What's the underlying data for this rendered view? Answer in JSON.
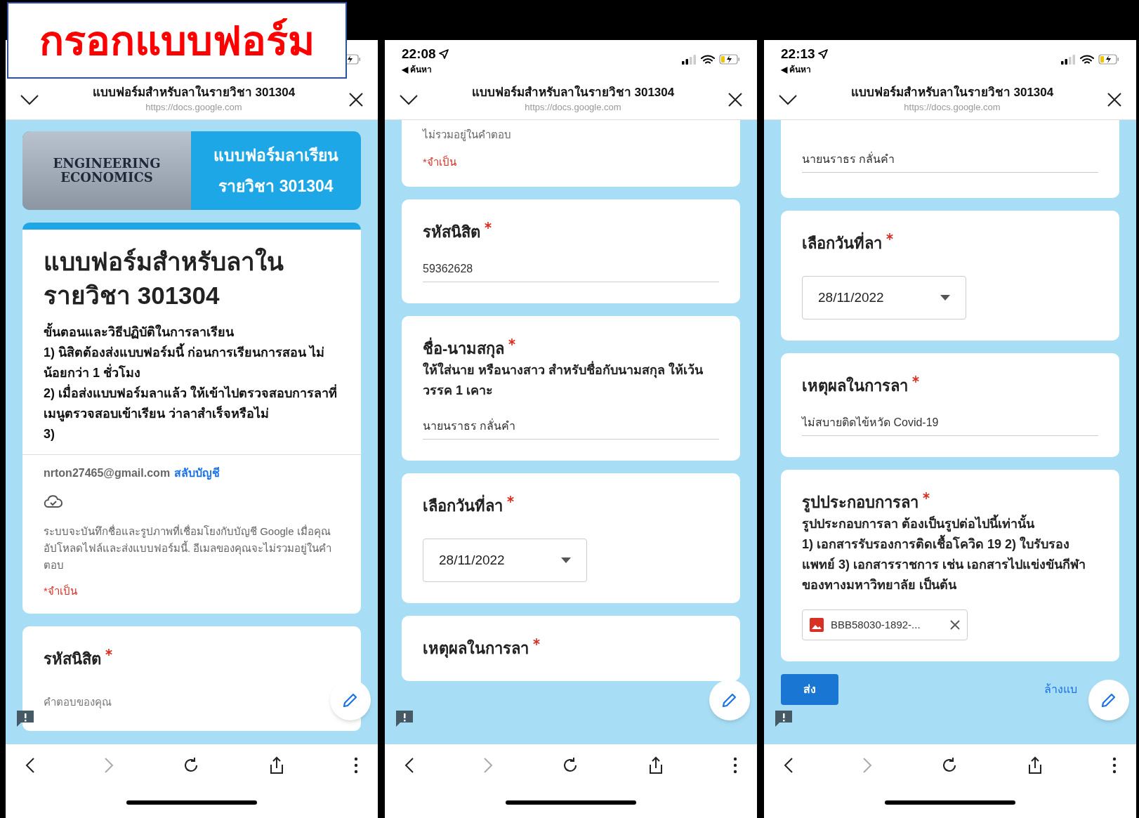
{
  "label": "กรอกแบบฟอร์ม",
  "phones": [
    {
      "header": {
        "title": "แบบฟอร์มสำหรับลาในรายวิชา 301304",
        "url": "https://docs.google.com"
      },
      "cards": [
        {
          "kind": "banner",
          "image_lines": [
            "ENGINEERING",
            "ECONOMICS"
          ],
          "lines": [
            "แบบฟอร์มลาเรียน",
            "รายวิชา 301304"
          ]
        },
        {
          "kind": "form_header",
          "title": "แบบฟอร์มสำหรับลาในรายวิชา 301304",
          "paragraphs": [
            "ขั้นตอนและวิธีปฏิบัติในการลาเรียน",
            "1) นิสิตต้องส่งแบบฟอร์มนี้ ก่อนการเรียนการสอน ไม่น้อยกว่า 1 ชั่วโมง",
            "2) เมื่อส่งแบบฟอร์มลาแล้ว ให้เข้าไปตรวจสอบการลาที่ เมนูตรวจสอบเข้าเรียน ว่าลาสำเร็จหรือไม่",
            "3)"
          ],
          "email": "nrton27465@gmail.com",
          "switch_link": "สลับบัญชี",
          "notice": "ระบบจะบันทึกชื่อและรูปภาพที่เชื่อมโยงกับบัญชี Google เมื่อคุณอัปโหลดไฟล์และส่งแบบฟอร์มนี้. อีเมลของคุณจะไม่รวมอยู่ในคำตอบ",
          "required_note": "*จำเป็น"
        },
        {
          "kind": "question",
          "title": "รหัสนิสิต",
          "required": true,
          "answer": {
            "kind": "empty",
            "placeholder": "คำตอบของคุณ"
          }
        }
      ]
    },
    {
      "time": "22:08",
      "back": "◀ ค้นหา",
      "header": {
        "title": "แบบฟอร์มสำหรับลาในรายวิชา 301304",
        "url": "https://docs.google.com"
      },
      "cards": [
        {
          "kind": "notice_tail",
          "notice": "ไม่รวมอยู่ในคำตอบ",
          "required_note": "*จำเป็น"
        },
        {
          "kind": "question",
          "title": "รหัสนิสิต",
          "required": true,
          "answer": {
            "kind": "text",
            "value": "59362628"
          }
        },
        {
          "kind": "question",
          "title": "ชื่อ-นามสกุล",
          "required": true,
          "paragraphs": [
            "ให้ใส่นาย หรือนางสาว สำหรับชื่อกับนามสกุล ให้เว้นวรรค 1 เคาะ"
          ],
          "answer": {
            "kind": "text",
            "value": "นายนราธร กลั่นคำ"
          }
        },
        {
          "kind": "question",
          "title": "เลือกวันที่ลา",
          "required": true,
          "answer": {
            "kind": "date",
            "value": "28/11/2022"
          }
        },
        {
          "kind": "question",
          "title": "เหตุผลในการลา",
          "required": true
        }
      ]
    },
    {
      "time": "22:13",
      "back": "◀ ค้นหา",
      "header": {
        "title": "แบบฟอร์มสำหรับลาในรายวิชา 301304",
        "url": "https://docs.google.com"
      },
      "cards": [
        {
          "kind": "continued",
          "answer": {
            "kind": "text",
            "value": "นายนราธร กลั่นคำ"
          }
        },
        {
          "kind": "question",
          "title": "เลือกวันที่ลา",
          "required": true,
          "answer": {
            "kind": "date",
            "value": "28/11/2022"
          }
        },
        {
          "kind": "question",
          "title": "เหตุผลในการลา",
          "required": true,
          "answer": {
            "kind": "text",
            "value": "ไม่สบายติดไข้หวัด Covid-19"
          }
        },
        {
          "kind": "question",
          "title": "รูปประกอบการลา",
          "required": true,
          "paragraphs": [
            "รูปประกอบการลา ต้องเป็นรูปต่อไปนี้เท่านั้น",
            "1) เอกสารรับรองการติดเชื้อโควิด 19 2) ใบรับรองแพทย์ 3) เอกสารราชการ เช่น เอกสารไปแข่งขันกีฬาของทางมหาวิทยาลัย เป็นต้น"
          ],
          "answer": {
            "kind": "file",
            "value": "BBB58030-1892-..."
          }
        },
        {
          "kind": "submit",
          "submit": "ส่ง",
          "clear": "ล้างแบ"
        }
      ]
    }
  ]
}
